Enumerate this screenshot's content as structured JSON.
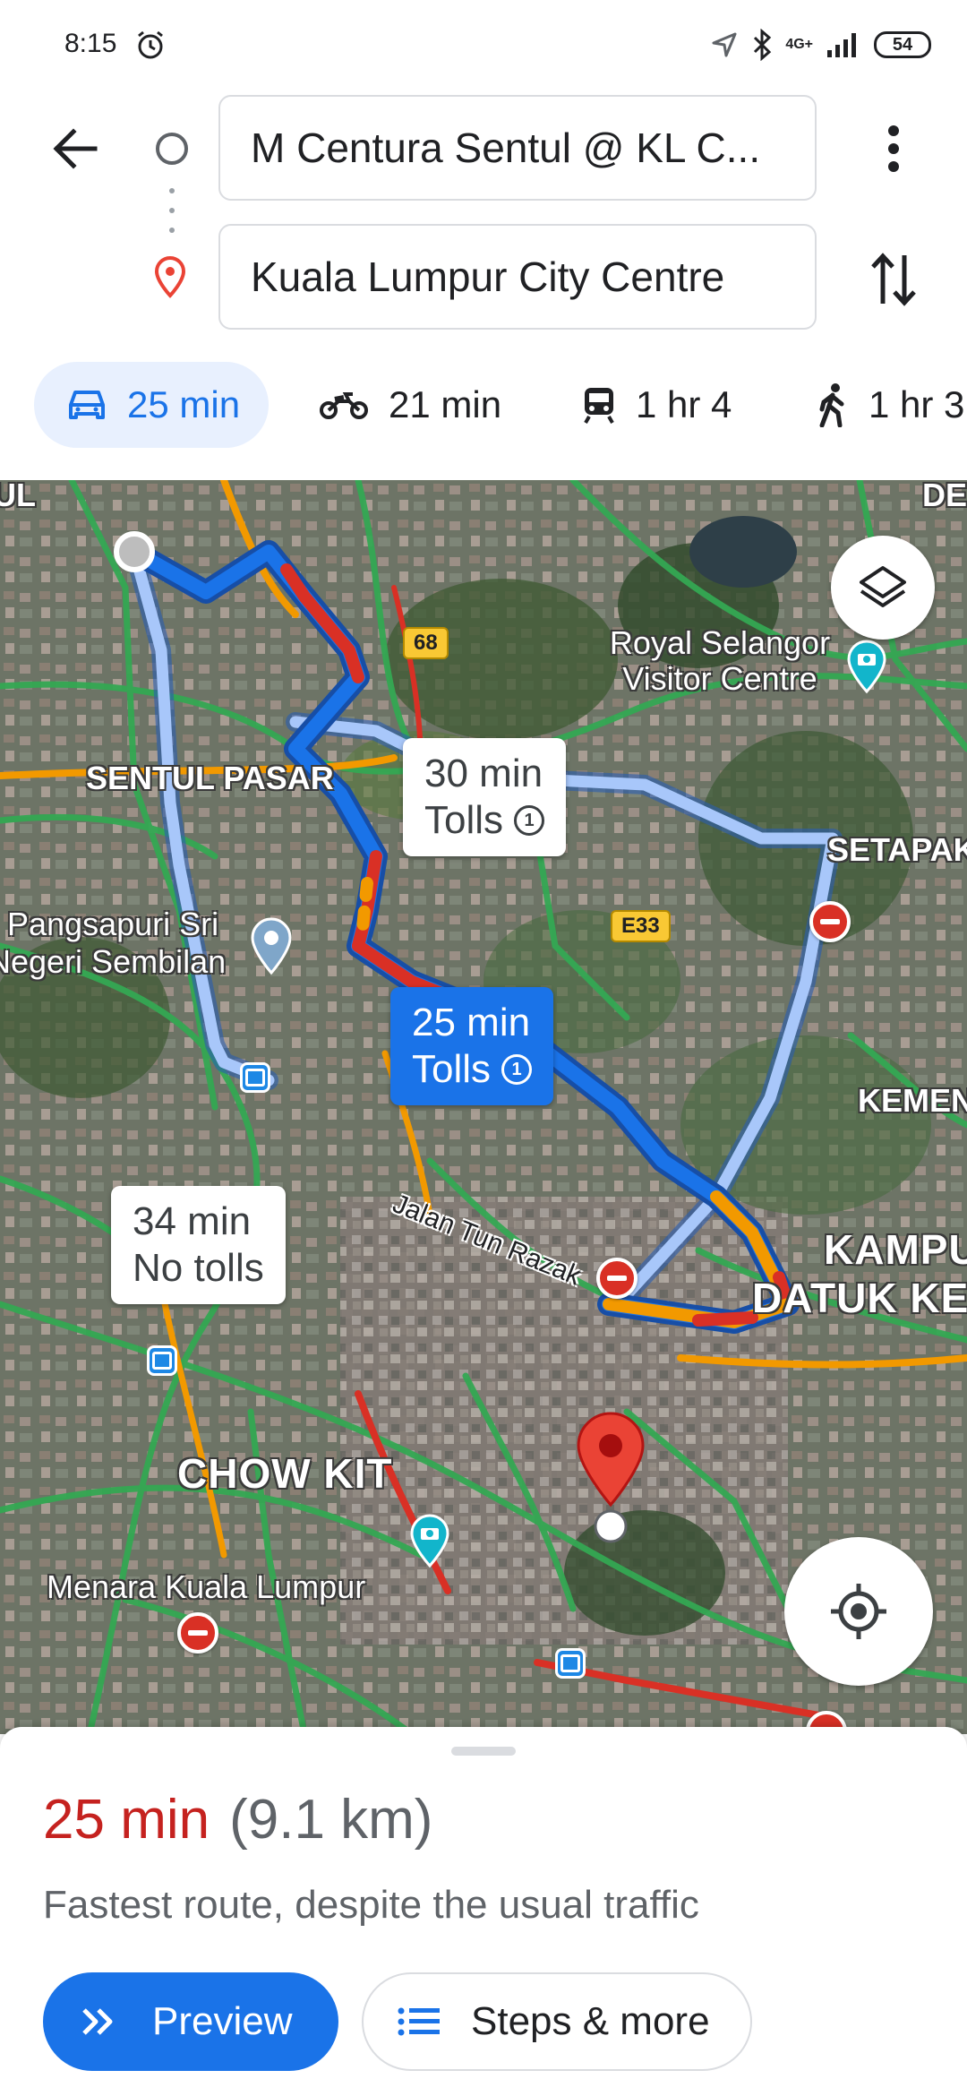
{
  "status_bar": {
    "time": "8:15",
    "network": "4G+",
    "battery": "54"
  },
  "header": {
    "origin": "M Centura Sentul @ KL C...",
    "destination": "Kuala Lumpur City Centre"
  },
  "modes": [
    {
      "label": "25 min",
      "icon": "car-icon",
      "selected": true
    },
    {
      "label": "21 min",
      "icon": "motorcycle-icon",
      "selected": false
    },
    {
      "label": "1 hr 4",
      "icon": "train-icon",
      "selected": false
    },
    {
      "label": "1 hr 3",
      "icon": "walk-icon",
      "selected": false
    }
  ],
  "map": {
    "labels": {
      "ul": "UL",
      "de": "DE",
      "sentul_pasar": "SENTUL PASAR",
      "royal_selangor": "Royal Selangor Visitor Centre",
      "setapak": "SETAPAK",
      "pangsapuri_1": "Pangsapuri Sri",
      "pangsapuri_2": "Negeri Sembilan",
      "kemen": "KEMEN",
      "kampu": "KAMPU",
      "datuk_ke": "DATUK KE",
      "chow_kit": "CHOW KIT",
      "menara": "Menara Kuala Lumpur",
      "jalan_tun_razak": "Jalan Tun Razak"
    },
    "shields": {
      "r68": "68",
      "e33": "E33"
    },
    "routes": [
      {
        "duration": "30 min",
        "note": "Tolls",
        "selected": false
      },
      {
        "duration": "25 min",
        "note": "Tolls",
        "selected": true
      },
      {
        "duration": "34 min",
        "note": "No tolls",
        "selected": false
      }
    ],
    "colors": {
      "route_selected": "#1a73e8",
      "route_alt": "#a8c7fa",
      "traffic_heavy": "#d93025",
      "traffic_medium": "#f29900",
      "traffic_free": "#34a853",
      "destination_pin": "#ea4335"
    }
  },
  "sheet": {
    "duration": "25 min",
    "distance": "(9.1 km)",
    "description": "Fastest route, despite the usual traffic",
    "preview_label": "Preview",
    "steps_label": "Steps & more"
  }
}
